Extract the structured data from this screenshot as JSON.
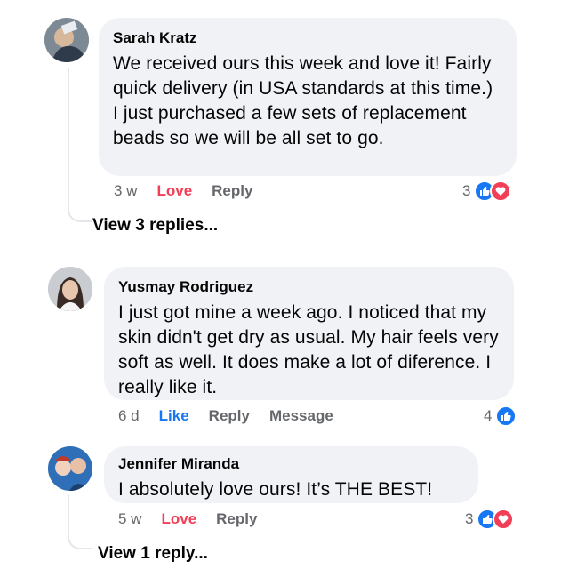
{
  "comments": [
    {
      "author": "Sarah Kratz",
      "text": "We received ours this week and love it! Fairly quick delivery (in USA standards at this time.) I just purchased a few sets of replacement beads so we will be all set to go.",
      "time": "3 w",
      "reaction_action": "Love",
      "reply_label": "Reply",
      "reaction_count": "3",
      "reaction_icons": [
        "like-icon",
        "love-icon"
      ],
      "view_replies": "View 3 replies..."
    },
    {
      "author": "Yusmay Rodriguez",
      "text": "I just got mine a week ago.  I noticed that my skin didn't get dry as usual.  My hair feels very soft as well.  It does make a lot of diference.  I really like it.",
      "time": "6 d",
      "reaction_action": "Like",
      "reply_label": "Reply",
      "message_label": "Message",
      "reaction_count": "4",
      "reaction_icons": [
        "like-icon"
      ]
    },
    {
      "author": "Jennifer Miranda",
      "text": "I absolutely love ours!  It’s THE BEST!",
      "time": "5 w",
      "reaction_action": "Love",
      "reply_label": "Reply",
      "reaction_count": "3",
      "reaction_icons": [
        "like-icon",
        "love-icon"
      ],
      "view_replies": "View 1 reply..."
    }
  ],
  "colors": {
    "bubble": "#f0f2f5",
    "love": "#f33e58",
    "like": "#1877f2",
    "meta": "#65676b"
  }
}
